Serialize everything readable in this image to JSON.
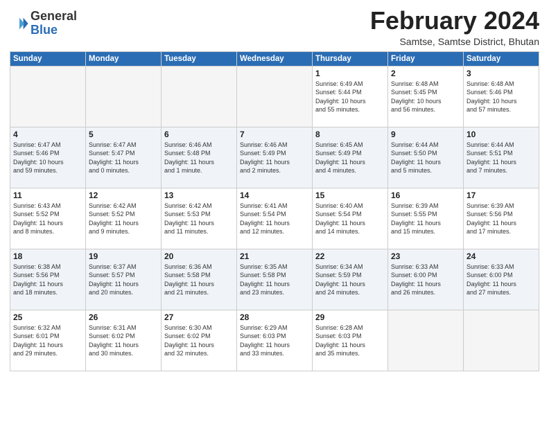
{
  "logo": {
    "general": "General",
    "blue": "Blue"
  },
  "header": {
    "month": "February 2024",
    "location": "Samtse, Samtse District, Bhutan"
  },
  "weekdays": [
    "Sunday",
    "Monday",
    "Tuesday",
    "Wednesday",
    "Thursday",
    "Friday",
    "Saturday"
  ],
  "weeks": [
    [
      {
        "day": "",
        "info": ""
      },
      {
        "day": "",
        "info": ""
      },
      {
        "day": "",
        "info": ""
      },
      {
        "day": "",
        "info": ""
      },
      {
        "day": "1",
        "info": "Sunrise: 6:49 AM\nSunset: 5:44 PM\nDaylight: 10 hours\nand 55 minutes."
      },
      {
        "day": "2",
        "info": "Sunrise: 6:48 AM\nSunset: 5:45 PM\nDaylight: 10 hours\nand 56 minutes."
      },
      {
        "day": "3",
        "info": "Sunrise: 6:48 AM\nSunset: 5:46 PM\nDaylight: 10 hours\nand 57 minutes."
      }
    ],
    [
      {
        "day": "4",
        "info": "Sunrise: 6:47 AM\nSunset: 5:46 PM\nDaylight: 10 hours\nand 59 minutes."
      },
      {
        "day": "5",
        "info": "Sunrise: 6:47 AM\nSunset: 5:47 PM\nDaylight: 11 hours\nand 0 minutes."
      },
      {
        "day": "6",
        "info": "Sunrise: 6:46 AM\nSunset: 5:48 PM\nDaylight: 11 hours\nand 1 minute."
      },
      {
        "day": "7",
        "info": "Sunrise: 6:46 AM\nSunset: 5:49 PM\nDaylight: 11 hours\nand 2 minutes."
      },
      {
        "day": "8",
        "info": "Sunrise: 6:45 AM\nSunset: 5:49 PM\nDaylight: 11 hours\nand 4 minutes."
      },
      {
        "day": "9",
        "info": "Sunrise: 6:44 AM\nSunset: 5:50 PM\nDaylight: 11 hours\nand 5 minutes."
      },
      {
        "day": "10",
        "info": "Sunrise: 6:44 AM\nSunset: 5:51 PM\nDaylight: 11 hours\nand 7 minutes."
      }
    ],
    [
      {
        "day": "11",
        "info": "Sunrise: 6:43 AM\nSunset: 5:52 PM\nDaylight: 11 hours\nand 8 minutes."
      },
      {
        "day": "12",
        "info": "Sunrise: 6:42 AM\nSunset: 5:52 PM\nDaylight: 11 hours\nand 9 minutes."
      },
      {
        "day": "13",
        "info": "Sunrise: 6:42 AM\nSunset: 5:53 PM\nDaylight: 11 hours\nand 11 minutes."
      },
      {
        "day": "14",
        "info": "Sunrise: 6:41 AM\nSunset: 5:54 PM\nDaylight: 11 hours\nand 12 minutes."
      },
      {
        "day": "15",
        "info": "Sunrise: 6:40 AM\nSunset: 5:54 PM\nDaylight: 11 hours\nand 14 minutes."
      },
      {
        "day": "16",
        "info": "Sunrise: 6:39 AM\nSunset: 5:55 PM\nDaylight: 11 hours\nand 15 minutes."
      },
      {
        "day": "17",
        "info": "Sunrise: 6:39 AM\nSunset: 5:56 PM\nDaylight: 11 hours\nand 17 minutes."
      }
    ],
    [
      {
        "day": "18",
        "info": "Sunrise: 6:38 AM\nSunset: 5:56 PM\nDaylight: 11 hours\nand 18 minutes."
      },
      {
        "day": "19",
        "info": "Sunrise: 6:37 AM\nSunset: 5:57 PM\nDaylight: 11 hours\nand 20 minutes."
      },
      {
        "day": "20",
        "info": "Sunrise: 6:36 AM\nSunset: 5:58 PM\nDaylight: 11 hours\nand 21 minutes."
      },
      {
        "day": "21",
        "info": "Sunrise: 6:35 AM\nSunset: 5:58 PM\nDaylight: 11 hours\nand 23 minutes."
      },
      {
        "day": "22",
        "info": "Sunrise: 6:34 AM\nSunset: 5:59 PM\nDaylight: 11 hours\nand 24 minutes."
      },
      {
        "day": "23",
        "info": "Sunrise: 6:33 AM\nSunset: 6:00 PM\nDaylight: 11 hours\nand 26 minutes."
      },
      {
        "day": "24",
        "info": "Sunrise: 6:33 AM\nSunset: 6:00 PM\nDaylight: 11 hours\nand 27 minutes."
      }
    ],
    [
      {
        "day": "25",
        "info": "Sunrise: 6:32 AM\nSunset: 6:01 PM\nDaylight: 11 hours\nand 29 minutes."
      },
      {
        "day": "26",
        "info": "Sunrise: 6:31 AM\nSunset: 6:02 PM\nDaylight: 11 hours\nand 30 minutes."
      },
      {
        "day": "27",
        "info": "Sunrise: 6:30 AM\nSunset: 6:02 PM\nDaylight: 11 hours\nand 32 minutes."
      },
      {
        "day": "28",
        "info": "Sunrise: 6:29 AM\nSunset: 6:03 PM\nDaylight: 11 hours\nand 33 minutes."
      },
      {
        "day": "29",
        "info": "Sunrise: 6:28 AM\nSunset: 6:03 PM\nDaylight: 11 hours\nand 35 minutes."
      },
      {
        "day": "",
        "info": ""
      },
      {
        "day": "",
        "info": ""
      }
    ]
  ]
}
